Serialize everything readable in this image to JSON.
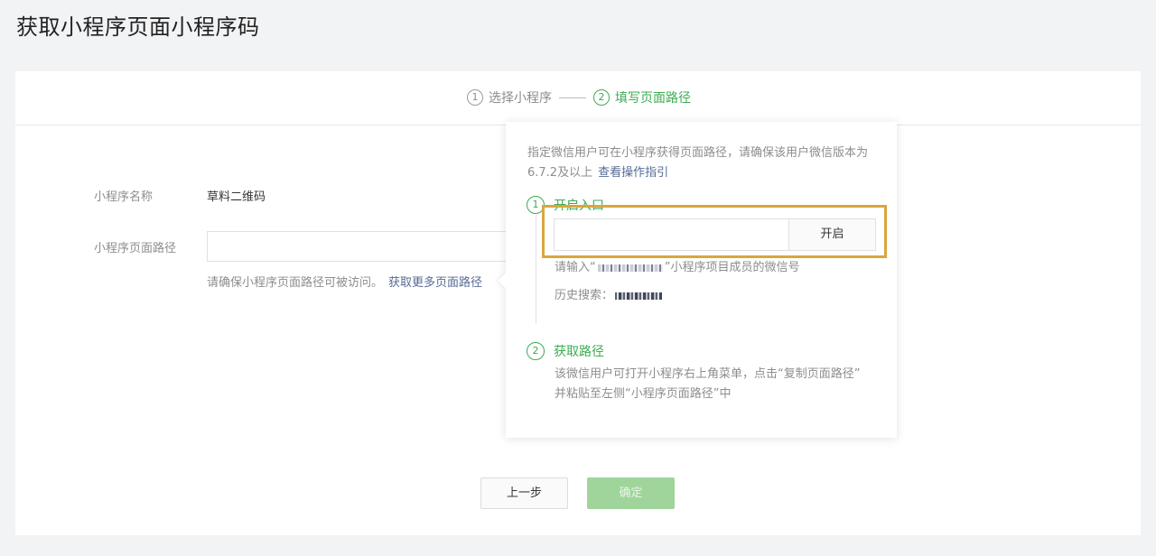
{
  "page": {
    "title": "获取小程序页面小程序码"
  },
  "steps": [
    {
      "num": "1",
      "label": "选择小程序"
    },
    {
      "num": "2",
      "label": "填写页面路径"
    }
  ],
  "form": {
    "name_label": "小程序名称",
    "name_value": "草料二维码",
    "path_label": "小程序页面路径",
    "path_value": "",
    "hint_text": "请确保小程序页面路径可被访问。",
    "hint_link": "获取更多页面路径"
  },
  "popover": {
    "desc_text": "指定微信用户可在小程序获得页面路径，请确保该用户微信版本为6.7.2及以上",
    "desc_link": "查看操作指引",
    "step1": {
      "num": "1",
      "title": "开启入口"
    },
    "open_input_value": "",
    "open_button": "开启",
    "note_prefix": "请输入“",
    "note_suffix": "”小程序项目成员的微信号",
    "history_label": "历史搜索：",
    "step2": {
      "num": "2",
      "title": "获取路径"
    },
    "step2_desc_line1": "该微信用户可打开小程序右上角菜单，点击“复制页面路径”",
    "step2_desc_line2": "并粘贴至左侧“小程序页面路径”中"
  },
  "buttons": {
    "prev": "上一步",
    "confirm": "确定"
  },
  "colors": {
    "accent": "#3dab52",
    "link": "#576b95",
    "highlight": "#d9a63e"
  }
}
